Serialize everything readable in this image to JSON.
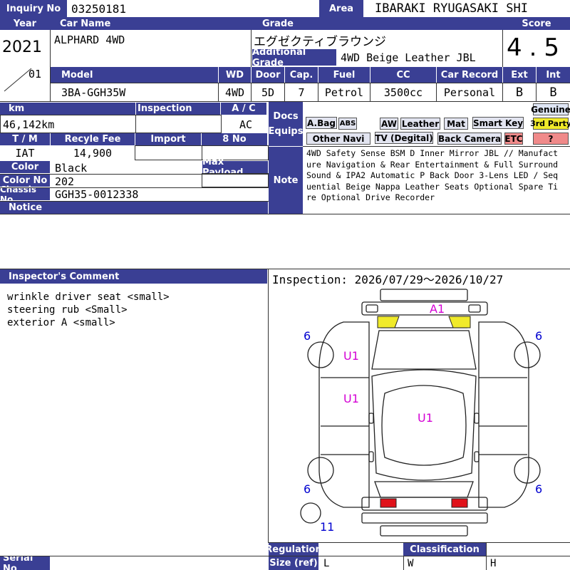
{
  "header": {
    "inquiry_label": "Inquiry No",
    "inquiry_no": "03250181",
    "area_label": "Area",
    "area": "IBARAKI RYUGASAKI SHI"
  },
  "row1": {
    "year_label": "Year",
    "year": "2021",
    "month": "01",
    "car_name_label": "Car Name",
    "car_name": "ALPHARD 4WD",
    "grade_label": "Grade",
    "grade": "エグゼクティブラウンジ",
    "additional_grade_label": "Additional Grade",
    "additional_grade": "4WD Beige Leather JBL",
    "score_label": "Score",
    "score": "4.5"
  },
  "row2": {
    "model_label": "Model",
    "model": "3BA-GGH35W",
    "wd_label": "WD",
    "wd": "4WD",
    "door_label": "Door",
    "door": "5D",
    "cap_label": "Cap.",
    "cap": "7",
    "fuel_label": "Fuel",
    "fuel": "Petrol",
    "cc_label": "CC",
    "cc": "3500cc",
    "record_label": "Car Record",
    "record": "Personal",
    "ext_label": "Ext",
    "ext": "B",
    "int_label": "Int",
    "int": "B"
  },
  "details": {
    "km_label": "km",
    "km": "46,142km",
    "inspection_label": "Inspection",
    "inspection": "",
    "ac_label": "A / C",
    "ac": "AC",
    "tm_label": "T / M",
    "tm": "IAT",
    "recycle_label": "Recyle Fee",
    "recycle": "14,900",
    "import_label": "Import",
    "no8_label": "8 No",
    "color_label": "Color",
    "color": "Black",
    "payload_label": "Max Payload",
    "colorno_label": "Color No",
    "colorno": "202",
    "chassis_label": "Chassis No",
    "chassis": "GGH35-0012338",
    "notice_label": "Notice"
  },
  "equip": {
    "docs_label_1": "Docs",
    "docs_label_2": "Equips",
    "genuine": "Genuine",
    "third_party": "3rd Party",
    "question": "?",
    "abag": "A.Bag",
    "abs": "ABS",
    "aw": "AW",
    "leather": "Leather",
    "mat": "Mat",
    "smart_key": "Smart Key",
    "other_navi": "Other Navi",
    "tv": "TV (Degital)",
    "back_camera": "Back Camera",
    "etc": "ETC"
  },
  "note": {
    "label": "Note",
    "text": "4WD Safety Sense BSM D Inner Mirror JBL // Manufacture Navigation & Rear Entertainment & Full Surround Sound & IPA2 Automatic P Back Door 3-Lens LED / Sequential Beige Nappa Leather Seats Optional Spare Tire Optional Drive Recorder"
  },
  "inspector": {
    "label": "Inspector's Comment",
    "comment": "wrinkle driver seat <small>\nsteering rub <Small>\nexterior A <small>",
    "inspection_period": "Inspection: 2026/07/29～2026/10/27"
  },
  "diagram": {
    "mark_a1": "A1",
    "mark_u1_a": "U1",
    "mark_u1_b": "U1",
    "mark_u1_c": "U1",
    "mark_6_tl": "6",
    "mark_6_tr": "6",
    "mark_6_bl": "6",
    "mark_6_br": "6",
    "mark_11": "11",
    "colors": {
      "yellow": "#f0ea2a",
      "red": "#e0121a",
      "magenta": "#d400d4",
      "blue": "#0000d0"
    }
  },
  "footer": {
    "serial_label": "Serial No",
    "regulation_label": "Regulation",
    "size_label": "Size (ref)",
    "classification_label": "Classification",
    "l": "L",
    "w": "W",
    "h": "H"
  },
  "theme": {
    "header_bg": "#3a3f94"
  }
}
